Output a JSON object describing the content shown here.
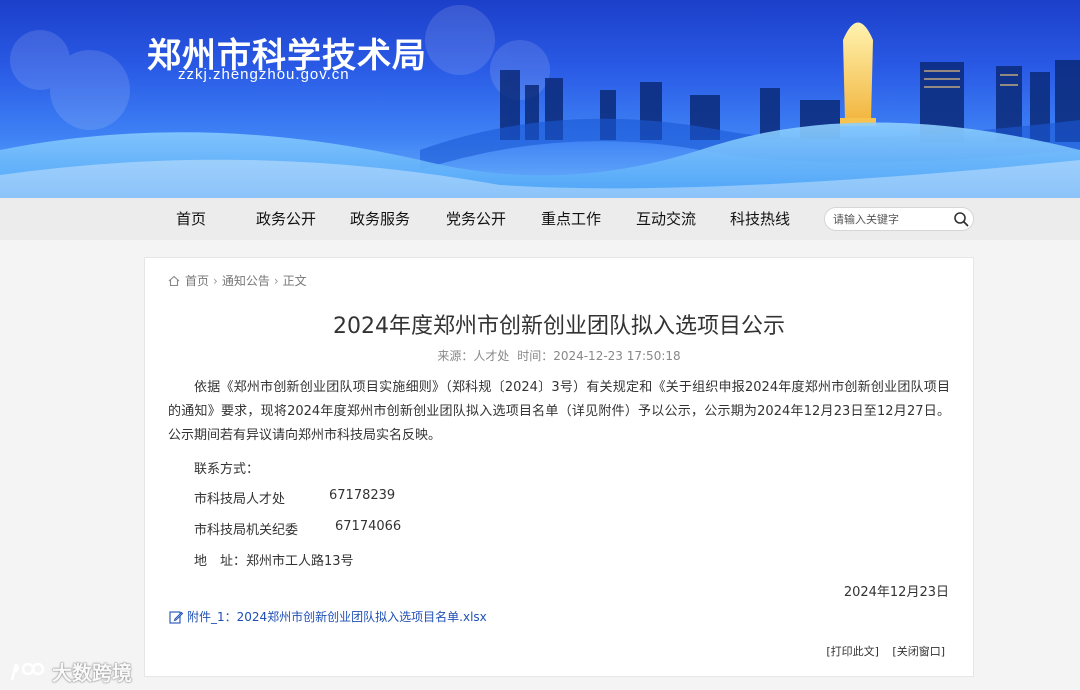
{
  "header": {
    "site_title": "郑州市科学技术局",
    "site_domain": "zzkj.zhengzhou.gov.cn"
  },
  "nav": {
    "items": [
      {
        "label": "首页"
      },
      {
        "label": "政务公开"
      },
      {
        "label": "政务服务"
      },
      {
        "label": "党务公开"
      },
      {
        "label": "重点工作"
      },
      {
        "label": "互动交流"
      },
      {
        "label": "科技热线"
      }
    ],
    "search_placeholder": "请输入关键字"
  },
  "breadcrumb": {
    "home": "首页",
    "section": "通知公告",
    "current": "正文"
  },
  "article": {
    "title": "2024年度郑州市创新创业团队拟入选项目公示",
    "source": "来源：人才处",
    "time": "时间：2024-12-23 17:50:18",
    "paragraph": "依据《郑州市创新创业团队项目实施细则》（郑科规〔2024〕3号）有关规定和《关于组织申报2024年度郑州市创新创业团队项目的通知》要求，现将2024年度郑州市创新创业团队拟入选项目名单（详见附件）予以公示，公示期为2024年12月23日至12月27日。公示期间若有异议请向郑州市科技局实名反映。",
    "contact_label": "联系方式：",
    "contact_1_name": "市科技局人才处",
    "contact_1_phone": "67178239",
    "contact_2_name": "市科技局机关纪委",
    "contact_2_phone": "67174066",
    "address": "地　址：郑州市工人路13号",
    "date": "2024年12月23日",
    "attachment": "附件_1：2024郑州市创新创业团队拟入选项目名单.xlsx"
  },
  "tools": {
    "print": "[打印此文]",
    "close": "[关闭窗口]"
  },
  "watermark": "大数跨境",
  "colors": {
    "banner_top": "#1c3fc9",
    "banner_bottom": "#6fb4fb",
    "nav_bg": "#ececec",
    "link": "#1f4fb5"
  }
}
